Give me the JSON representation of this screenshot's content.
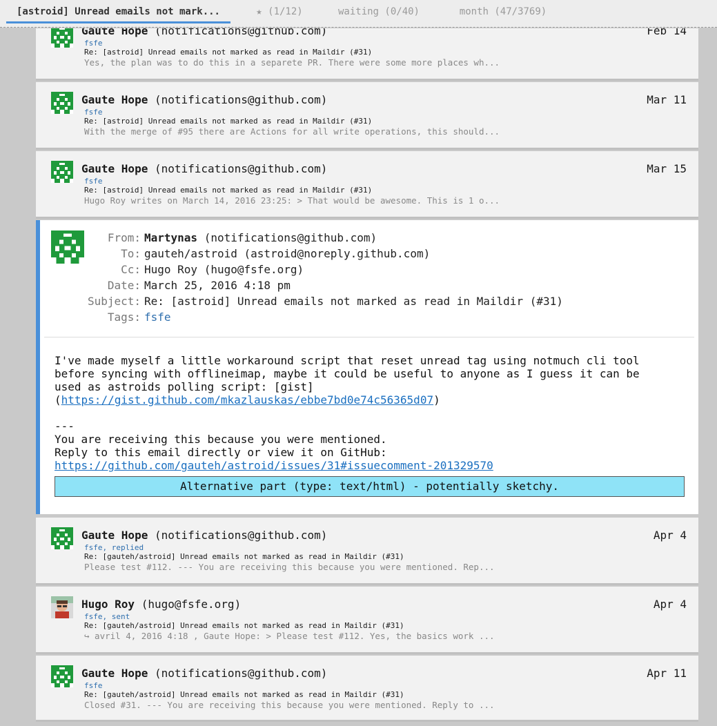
{
  "tabs": [
    {
      "label": "[astroid] Unread emails not mark..."
    },
    {
      "label": "★ (1/12)"
    },
    {
      "label": "waiting (0/40)"
    },
    {
      "label": "month (47/3769)"
    }
  ],
  "messages": [
    {
      "name": "Gaute Hope",
      "email": "(notifications@github.com)",
      "date": "Feb 14",
      "tags": "fsfe",
      "subject": "Re: [astroid] Unread emails not marked as read in Maildir (#31)",
      "preview": "Yes, the plan was to do this in a separete PR. There were some more places wh..."
    },
    {
      "name": "Gaute Hope",
      "email": "(notifications@github.com)",
      "date": "Mar 11",
      "tags": "fsfe",
      "subject": "Re: [astroid] Unread emails not marked as read in Maildir (#31)",
      "preview": "With the merge of #95 there are Actions for all write operations, this should..."
    },
    {
      "name": "Gaute Hope",
      "email": "(notifications@github.com)",
      "date": "Mar 15",
      "tags": "fsfe",
      "subject": "Re: [astroid] Unread emails not marked as read in Maildir (#31)",
      "preview": "Hugo Roy writes on March 14, 2016 23:25: > That would be awesome. This is 1 o..."
    },
    {
      "name": "Gaute Hope",
      "email": "(notifications@github.com)",
      "date": "Apr 4",
      "tags": "fsfe, replied",
      "subject": "Re: [gauteh/astroid] Unread emails not marked as read in Maildir (#31)",
      "preview": "Please test #112. --- You are receiving this because you were mentioned. Rep..."
    },
    {
      "name": "Hugo Roy",
      "email": "(hugo@fsfe.org)",
      "date": "Apr 4",
      "tags": "fsfe, sent",
      "subject": "Re: [gauteh/astroid] Unread emails not marked as read in Maildir (#31)",
      "preview": "↪ avril 4, 2016 4:18 , Gaute Hope: > Please test #112. Yes, the basics work ..."
    },
    {
      "name": "Gaute Hope",
      "email": "(notifications@github.com)",
      "date": "Apr 11",
      "tags": "fsfe",
      "subject": "Re: [gauteh/astroid] Unread emails not marked as read in Maildir (#31)",
      "preview": "Closed #31. --- You are receiving this because you were mentioned. Reply to ..."
    }
  ],
  "expanded": {
    "labels": {
      "from": "From:",
      "to": "To:",
      "cc": "Cc:",
      "date": "Date:",
      "subject": "Subject:",
      "tags": "Tags:"
    },
    "from_name": "Martynas",
    "from_email": "(notifications@github.com)",
    "to": "gauteh/astroid (astroid@noreply.github.com)",
    "cc": "Hugo Roy (hugo@fsfe.org)",
    "date": "March 25, 2016 4:18 pm",
    "subject": "Re: [astroid] Unread emails not marked as read in Maildir (#31)",
    "tags": "fsfe",
    "body_line1": "I've made myself a little workaround script that reset unread tag using notmuch cli tool",
    "body_line2": "before syncing with offlineimap, maybe it could be useful to anyone as I guess it can be",
    "body_line3": "used as astroids polling script: [gist]",
    "gist_open": "(",
    "gist_link": "https://gist.github.com/mkazlauskas/ebbe7bd0e74c56365d07",
    "gist_close": ")",
    "sig_sep": "---",
    "sig_line1": "You are receiving this because you were mentioned.",
    "sig_line2": "Reply to this email directly or view it on GitHub:",
    "github_link": "https://github.com/gauteh/astroid/issues/31#issuecomment-201329570",
    "alt_part": "Alternative part (type: text/html) - potentially sketchy."
  }
}
